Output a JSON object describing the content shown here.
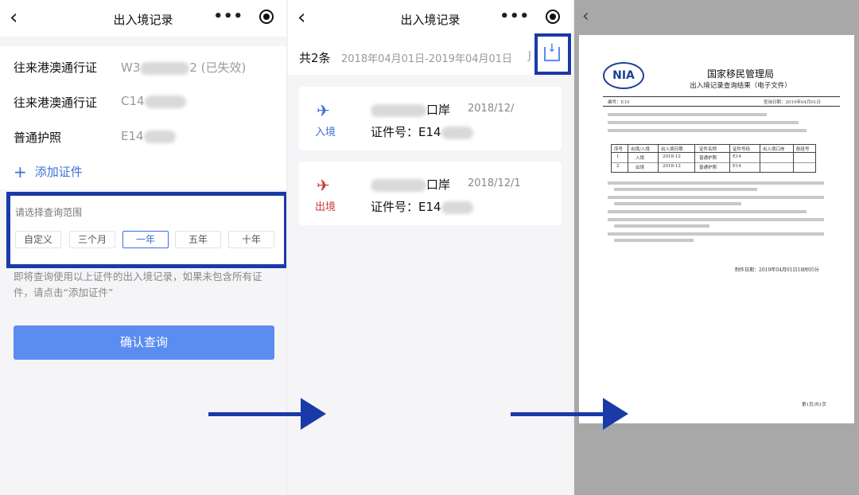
{
  "screen1": {
    "title": "出入境记录",
    "back": "‹",
    "more": "•••",
    "credentials": [
      {
        "name": "往来港澳通行证",
        "prefix": "W3",
        "suffix": "2 (已失效)"
      },
      {
        "name": "往来港澳通行证",
        "prefix": "C14",
        "suffix": ""
      },
      {
        "name": "普通护照",
        "prefix": "E14",
        "suffix": ""
      }
    ],
    "add_label": "添加证件",
    "range_label": "请选择查询范围",
    "ranges": [
      "自定义",
      "三个月",
      "一年",
      "五年",
      "十年"
    ],
    "active_range": "一年",
    "note": "即将查询使用以上证件的出入境记录，如果未包含所有证件，请点击“添加证件”",
    "confirm_label": "确认查询"
  },
  "screen2": {
    "title": "出入境记录",
    "back": "‹",
    "more": "•••",
    "count": "共2条",
    "date_range": "2018年04月01日-2019年04月01日",
    "trailing": "J",
    "records": [
      {
        "direction": "入境",
        "port_suffix": "口岸",
        "date": "2018/12/",
        "cert_label": "证件号：E14",
        "color": "#3d6fd8"
      },
      {
        "direction": "出境",
        "port_suffix": "口岸",
        "date": "2018/12/1",
        "cert_label": "证件号：E14",
        "color": "#c83a3a"
      }
    ]
  },
  "screen3": {
    "back": "‹",
    "doc": {
      "logo": "NIA",
      "title": "国家移民管理局",
      "subtitle": "出入境记录查询结果（电子文件）",
      "number_label": "编号：E10",
      "query_date": "查询日期：2019年04月01日",
      "table_headers": [
        "序号",
        "出境/入境",
        "出入境日期",
        "证件名称",
        "证件号码",
        "出入境口岸",
        "航班号"
      ],
      "rows": [
        {
          "no": "1",
          "dir": "入境",
          "date": "2018-12",
          "cert": "普通护照",
          "num": "E14"
        },
        {
          "no": "2",
          "dir": "出境",
          "date": "2018-12",
          "cert": "普通护照",
          "num": "E14"
        }
      ],
      "issue_date": "制作日期：2019年04月01日18时05分",
      "page": "第1页/共1页"
    }
  }
}
